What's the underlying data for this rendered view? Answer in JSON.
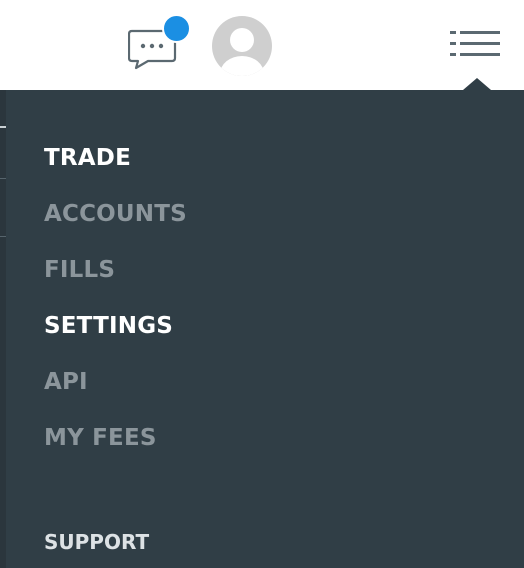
{
  "header": {
    "icons": {
      "messages": "chat-bubble-icon",
      "notification": "notification-badge",
      "profile": "user-avatar-icon",
      "menu": "menu-list-icon"
    },
    "colors": {
      "badge": "#1b8fe3",
      "avatar_bg": "#cfcfcf",
      "icon_stroke": "#5b6971"
    }
  },
  "menu": {
    "items": [
      {
        "label": "TRADE",
        "state": "highlighted"
      },
      {
        "label": "ACCOUNTS",
        "state": "muted"
      },
      {
        "label": "FILLS",
        "state": "muted"
      },
      {
        "label": "SETTINGS",
        "state": "highlighted"
      },
      {
        "label": "API",
        "state": "muted"
      },
      {
        "label": "MY FEES",
        "state": "muted"
      }
    ],
    "support_label": "SUPPORT",
    "colors": {
      "panel": "#303e46",
      "highlighted_text": "#ffffff",
      "muted_text": "#8b959b"
    }
  }
}
